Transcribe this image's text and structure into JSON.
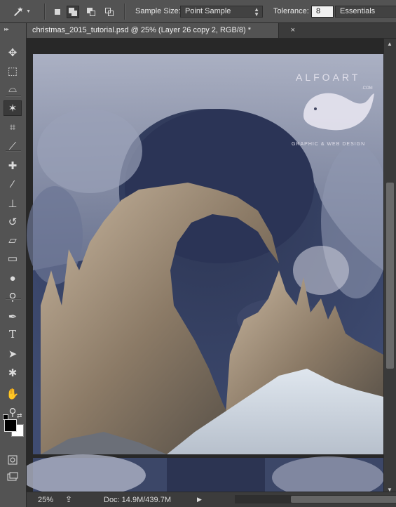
{
  "options_bar": {
    "tool_icon": "magic-wand-icon",
    "sample_size_label": "Sample Size:",
    "sample_size_value": "Point Sample",
    "tolerance_label": "Tolerance:",
    "tolerance_value": "8",
    "workspace_value": "Essentials"
  },
  "document": {
    "tab_title": "christmas_2015_tutorial.psd @ 25% (Layer 26 copy 2, RGB/8) *",
    "close_glyph": "×"
  },
  "canvas": {
    "watermark_top": "ALFOART",
    "watermark_bottom": "GRAPHIC & WEB DESIGN",
    "watermark_small": ".COM"
  },
  "toolbar": {
    "tools": [
      {
        "name": "move-tool",
        "icon": "move-icon",
        "glyph": "✥"
      },
      {
        "name": "marquee-tool",
        "icon": "rectangular-marquee-icon",
        "glyph": "⬚"
      },
      {
        "name": "lasso-tool",
        "icon": "polygonal-lasso-icon",
        "glyph": "⌓"
      },
      {
        "name": "magic-wand-tool",
        "icon": "magic-wand-icon",
        "glyph": "✶"
      },
      {
        "name": "crop-tool",
        "icon": "crop-icon",
        "glyph": "⌗"
      },
      {
        "name": "eyedropper-tool",
        "icon": "eyedropper-icon",
        "glyph": "⟋"
      },
      {
        "name": "healing-tool",
        "icon": "bandage-icon",
        "glyph": "✚"
      },
      {
        "name": "brush-tool",
        "icon": "brush-icon",
        "glyph": "⁄"
      },
      {
        "name": "stamp-tool",
        "icon": "clone-stamp-icon",
        "glyph": "⊥"
      },
      {
        "name": "history-brush-tool",
        "icon": "history-brush-icon",
        "glyph": "↺"
      },
      {
        "name": "eraser-tool",
        "icon": "eraser-icon",
        "glyph": "▱"
      },
      {
        "name": "gradient-tool",
        "icon": "gradient-icon",
        "glyph": "▭"
      },
      {
        "name": "blur-tool",
        "icon": "blur-drop-icon",
        "glyph": "●"
      },
      {
        "name": "dodge-tool",
        "icon": "dodge-icon",
        "glyph": "⚲"
      },
      {
        "name": "pen-tool",
        "icon": "pen-icon",
        "glyph": "✒"
      },
      {
        "name": "type-tool",
        "icon": "type-icon",
        "glyph": "T"
      },
      {
        "name": "path-selection-tool",
        "icon": "path-selection-icon",
        "glyph": "➤"
      },
      {
        "name": "shape-tool",
        "icon": "custom-shape-icon",
        "glyph": "✱"
      },
      {
        "name": "hand-tool",
        "icon": "hand-icon",
        "glyph": "✋"
      },
      {
        "name": "zoom-tool",
        "icon": "zoom-icon",
        "glyph": "⚲"
      }
    ],
    "foreground_color": "#000000",
    "background_color": "#ffffff"
  },
  "status": {
    "zoom": "25%",
    "doc_info": "Doc: 14.9M/439.7M"
  }
}
